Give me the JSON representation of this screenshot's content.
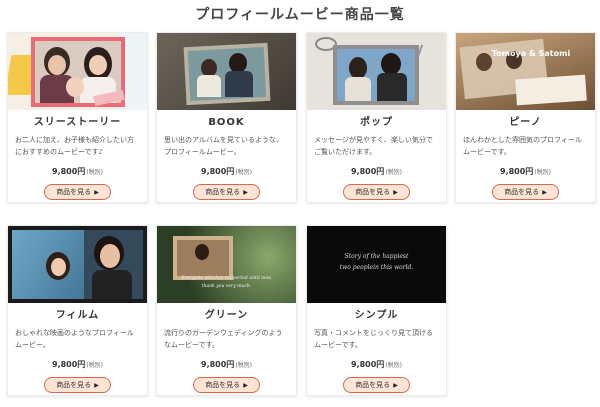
{
  "page": {
    "title": "プロフィールムービー商品一覧"
  },
  "common": {
    "button_label": "商品を見る",
    "tax_label": "(税別)"
  },
  "products": [
    {
      "name": "スリーストーリー",
      "description": "お二人に加え、お子様も紹介したい方におすすめのムービーです♪",
      "price": "9,800円"
    },
    {
      "name": "BOOK",
      "description": "思い出のアルバムを見ているような、プロフィールムービー。",
      "price": "9,800円"
    },
    {
      "name": "ポップ",
      "description": "メッセージが見やすく、楽しい気分でご覧いただけます。",
      "price": "9,800円"
    },
    {
      "name": "ピーノ",
      "description": "ほんわかとした雰囲気のプロフィールムービーです。",
      "price": "9,800円"
    },
    {
      "name": "フィルム",
      "description": "おしゃれな映画のようなプロフィールムービー。",
      "price": "9,800円"
    },
    {
      "name": "グリーン",
      "description": "流行りのガーデンウェディングのようなムービーです。",
      "price": "9,800円"
    },
    {
      "name": "シンプル",
      "description": "写真・コメントをじっくり見て頂けるムービーです。",
      "price": "9,800円"
    }
  ],
  "thumb_texts": {
    "pino_overlay": "Tomoya & Satomi",
    "green_caption_1": "Everyone who has supported until now,",
    "green_caption_2": "thank you very much.",
    "simple_caption_1": "Story of the happiest",
    "simple_caption_2": "two peoplein this world."
  }
}
